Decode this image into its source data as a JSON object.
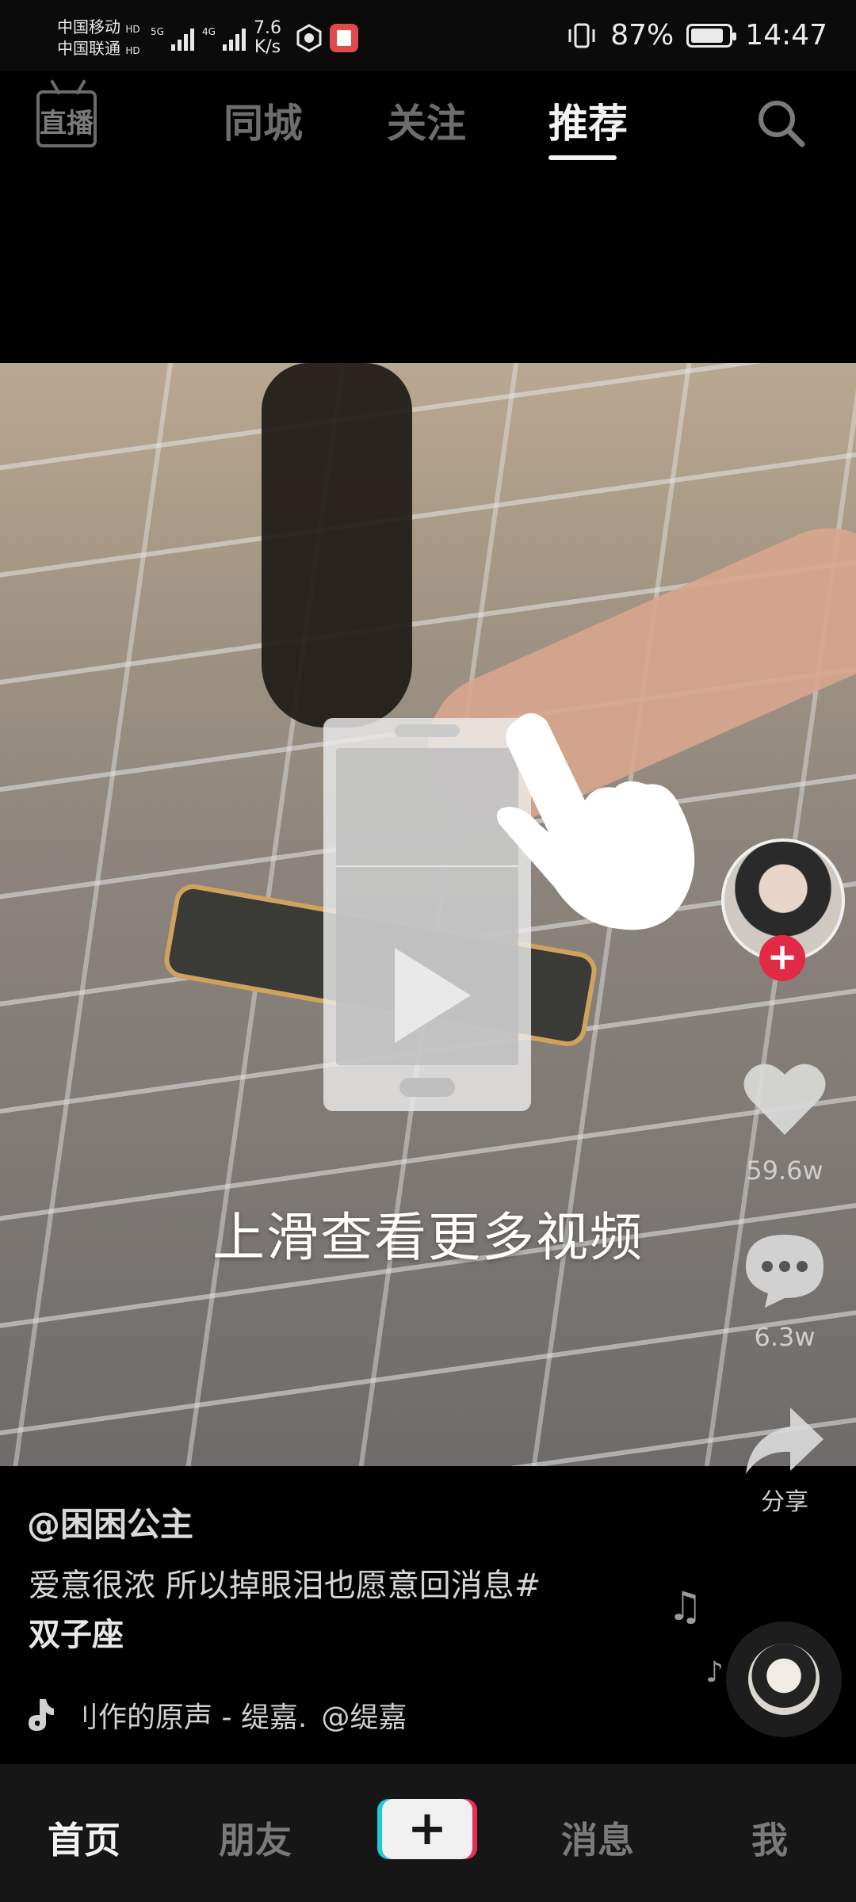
{
  "status_bar": {
    "carrier1": "中国移动",
    "carrier2": "中国联通",
    "hd": "HD",
    "net1": "5G",
    "net2": "4G",
    "speed_value": "7.6",
    "speed_unit": "K/s",
    "battery_text": "87%",
    "battery_level": 0.87,
    "time": "14:47"
  },
  "top_nav": {
    "live_label": "直播",
    "tabs": [
      {
        "label": "同城"
      },
      {
        "label": "关注"
      },
      {
        "label": "推荐"
      }
    ],
    "active_tab": "推荐"
  },
  "guide": {
    "text": "上滑查看更多视频"
  },
  "rail": {
    "like_count": "59.6w",
    "comment_count": "6.3w",
    "share_label": "分享",
    "follow_symbol": "+"
  },
  "post": {
    "author": "@困困公主",
    "description_text": "爱意很浓 所以掉眼泪也愿意回消息#",
    "description_tag": "双子座",
    "music_title": "刂作的原声 - 缇嘉.",
    "music_author": "@缇嘉"
  },
  "bottom_tabs": {
    "home": "首页",
    "friends": "朋友",
    "add": "+",
    "messages": "消息",
    "me": "我"
  },
  "colors": {
    "accent_red": "#e12b46",
    "cyan": "#20c9d8",
    "pink": "#e92f55"
  }
}
